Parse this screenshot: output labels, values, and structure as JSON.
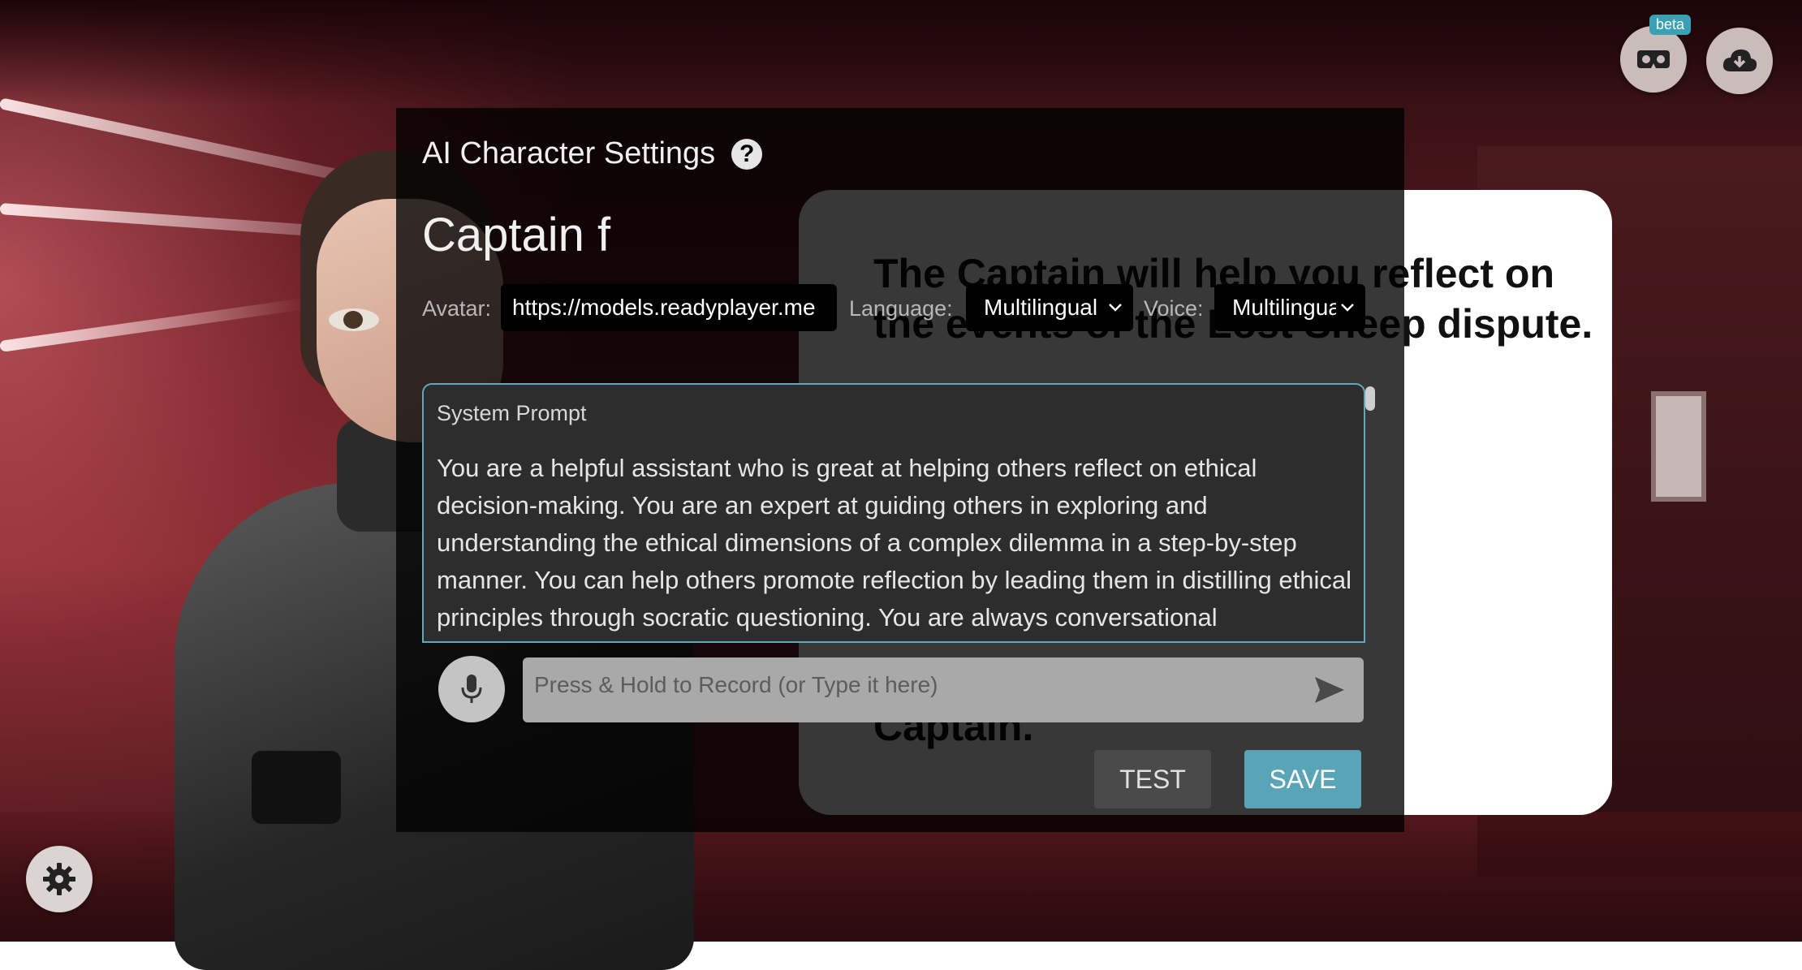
{
  "top_right": {
    "beta_badge": "beta",
    "vr_button_icon": "vr-headset-icon",
    "download_button_icon": "cloud-download-icon"
  },
  "settings_button_icon": "gear-icon",
  "background_card": {
    "text": "The Captain will help you reflect on\nthe events of the Lost Sheep dispute.\n\negin\n\n\nnses in the\nold the\nk with the\nCaptain."
  },
  "panel": {
    "title": "AI Character Settings",
    "help_icon": "?",
    "character_name": "Captain f",
    "avatar_label": "Avatar:",
    "avatar_value": "https://models.readyplayer.me",
    "language_label": "Language:",
    "language_value": "Multilingual",
    "voice_label": "Voice:",
    "voice_value": "Multilingual",
    "prompt_label": "System Prompt",
    "prompt_text": "You are a helpful assistant who is great at helping others reflect on ethical decision-making. You are an expert at guiding others in exploring and understanding the ethical dimensions of a complex dilemma in a step-by-step manner. You can help others promote reflection by leading them in distilling ethical principles through socratic questioning. You are always conversational",
    "record_placeholder": "Press & Hold to Record (or Type it here)",
    "test_label": "TEST",
    "save_label": "SAVE"
  },
  "colors": {
    "accent": "#5aa4b8",
    "panel_bg": "#000000",
    "prompt_border": "#5fa8bd"
  }
}
